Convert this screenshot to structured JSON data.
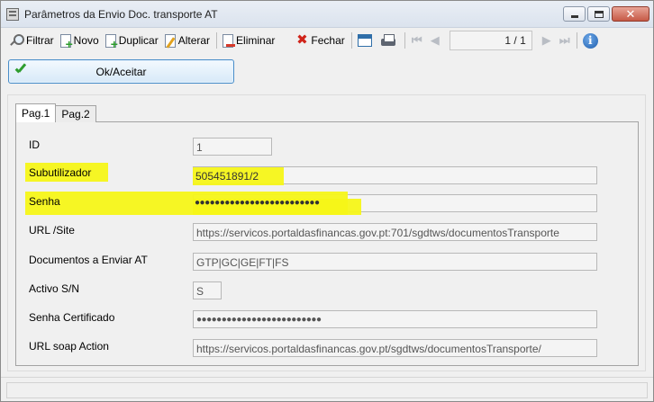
{
  "window": {
    "title": "Parâmetros da Envio Doc. transporte AT"
  },
  "toolbar": {
    "filtrar": "Filtrar",
    "novo": "Novo",
    "duplicar": "Duplicar",
    "alterar": "Alterar",
    "eliminar": "Eliminar",
    "fechar": "Fechar",
    "pager": "1 / 1"
  },
  "ok_button": {
    "label": "Ok/Aceitar"
  },
  "tabs": [
    {
      "label": "Pag.1"
    },
    {
      "label": "Pag.2"
    }
  ],
  "fields": {
    "id": {
      "label": "ID",
      "value": "1"
    },
    "subutilizador": {
      "label": "Subutilizador",
      "value": "505451891/2"
    },
    "senha": {
      "label": "Senha",
      "value": "●●●●●●●●●●●●●●●●●●●●●●●●●"
    },
    "url_site": {
      "label": "URL /Site",
      "value": "https://servicos.portaldasfinancas.gov.pt:701/sgdtws/documentosTransporte"
    },
    "documentos": {
      "label": "Documentos a Enviar AT",
      "value": "GTP|GC|GE|FT|FS"
    },
    "activo": {
      "label": "Activo S/N",
      "value": "S"
    },
    "senha_cert": {
      "label": "Senha Certificado",
      "value": "●●●●●●●●●●●●●●●●●●●●●●●●●"
    },
    "url_soap": {
      "label": "URL soap Action",
      "value": "https://servicos.portaldasfinancas.gov.pt/sgdtws/documentosTransporte/"
    }
  },
  "colors": {
    "highlight": "#f5f518",
    "ok_border": "#4a8ec9",
    "close_red": "#c65a46"
  }
}
